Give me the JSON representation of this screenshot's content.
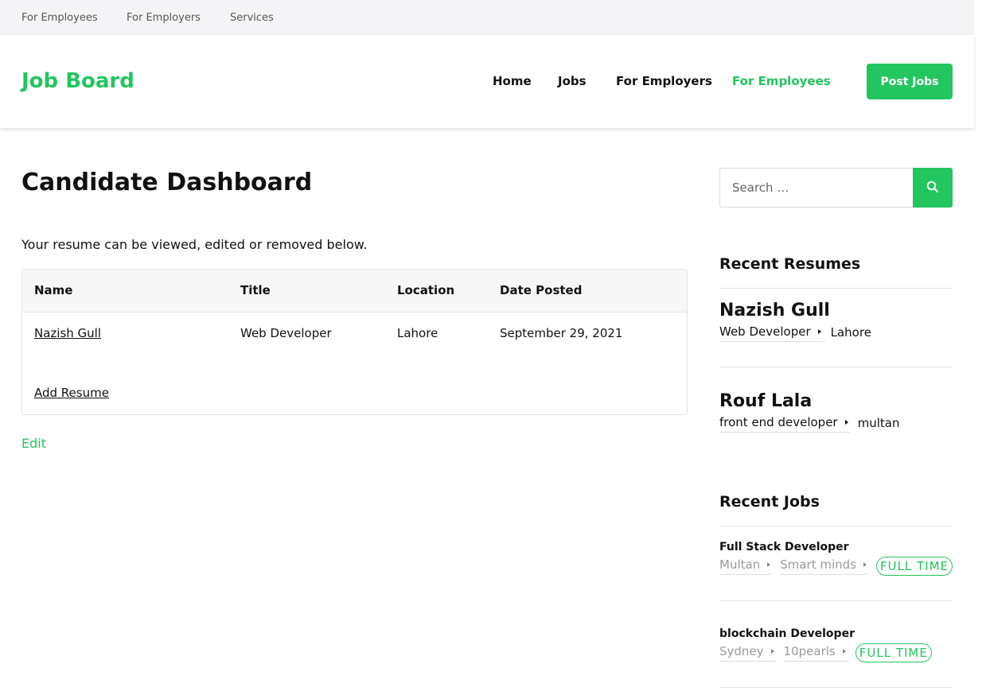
{
  "topbar": {
    "links": [
      "For Employees",
      "For Employers",
      "Services"
    ]
  },
  "header": {
    "logo": "Job Board",
    "nav": [
      "Home",
      "Jobs",
      "For Employers",
      "For Employees"
    ],
    "active_nav": "For Employees",
    "post_button": "Post Jobs"
  },
  "main": {
    "title": "Candidate Dashboard",
    "intro": "Your resume can be viewed, edited or removed below.",
    "table": {
      "headers": [
        "Name",
        "Title",
        "Location",
        "Date Posted"
      ],
      "rows": [
        [
          "Nazish Gull",
          "Web Developer",
          "Lahore",
          "September 29, 2021"
        ]
      ],
      "add_resume": "Add Resume"
    },
    "edit": "Edit"
  },
  "sidebar": {
    "search": {
      "placeholder": "Search …",
      "icon": "search-icon"
    },
    "recent_resumes": {
      "title": "Recent Resumes",
      "items": [
        {
          "name": "Nazish Gull",
          "title": "Web Developer",
          "location": "Lahore"
        },
        {
          "name": "Rouf Lala",
          "title": "front end developer",
          "location": "multan"
        }
      ]
    },
    "recent_jobs": {
      "title": "Recent Jobs",
      "items": [
        {
          "title": "Full Stack Developer",
          "location": "Multan",
          "company": "Smart minds",
          "type": "FULL TIME"
        },
        {
          "title": "blockchain Developer",
          "location": "Sydney",
          "company": "10pearls",
          "type": "FULL TIME"
        }
      ]
    }
  },
  "colors": {
    "accent": "#22c55e",
    "topbar_bg": "#f4f4f6",
    "table_header_bg": "#f7f7f7"
  }
}
